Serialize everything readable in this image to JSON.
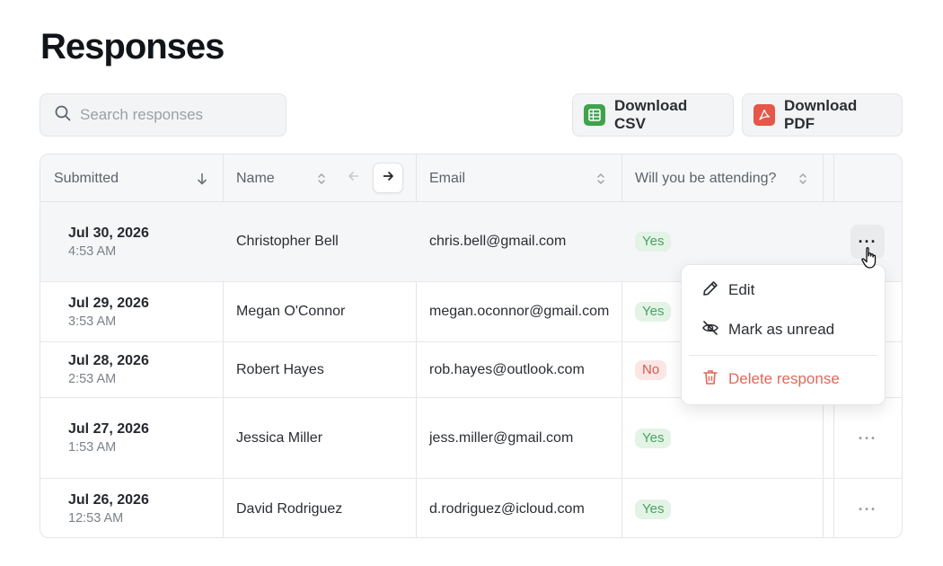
{
  "page": {
    "title": "Responses"
  },
  "search": {
    "placeholder": "Search responses",
    "icon": "search-icon"
  },
  "actions": {
    "csv": {
      "label": "Download CSV",
      "icon": "spreadsheet-icon",
      "color": "#3fa34d"
    },
    "pdf": {
      "label": "Download PDF",
      "icon": "pdf-icon",
      "color": "#e4574a"
    }
  },
  "table": {
    "columns": [
      {
        "label": "Submitted",
        "sort": "descending"
      },
      {
        "label": "Name",
        "sort": "none"
      },
      {
        "label": "Email",
        "sort": "none"
      },
      {
        "label": "Will you be attending?",
        "sort": "none"
      }
    ],
    "rows": [
      {
        "date": "Jul 30, 2026",
        "time": "4:53 AM",
        "name": "Christopher Bell",
        "email": "chris.bell@gmail.com",
        "attending": "Yes"
      },
      {
        "date": "Jul 29, 2026",
        "time": "3:53 AM",
        "name": "Megan O'Connor",
        "email": "megan.oconnor@gmail.com",
        "attending": "Yes"
      },
      {
        "date": "Jul 28, 2026",
        "time": "2:53 AM",
        "name": "Robert Hayes",
        "email": "rob.hayes@outlook.com",
        "attending": "No"
      },
      {
        "date": "Jul 27, 2026",
        "time": "1:53 AM",
        "name": "Jessica Miller",
        "email": "jess.miller@gmail.com",
        "attending": "Yes"
      },
      {
        "date": "Jul 26, 2026",
        "time": "12:53 AM",
        "name": "David Rodriguez",
        "email": "d.rodriguez@icloud.com",
        "attending": "Yes"
      }
    ],
    "more_label": "···"
  },
  "row_menu": {
    "items": [
      {
        "label": "Edit",
        "icon": "pencil-icon"
      },
      {
        "label": "Mark as unread",
        "icon": "eye-off-icon"
      },
      {
        "label": "Delete response",
        "icon": "trash-icon",
        "danger": true
      }
    ]
  },
  "colors": {
    "yes_bg": "#e3f3e6",
    "yes_fg": "#4aa363",
    "no_bg": "#fbe6e4",
    "no_fg": "#d9584a"
  }
}
